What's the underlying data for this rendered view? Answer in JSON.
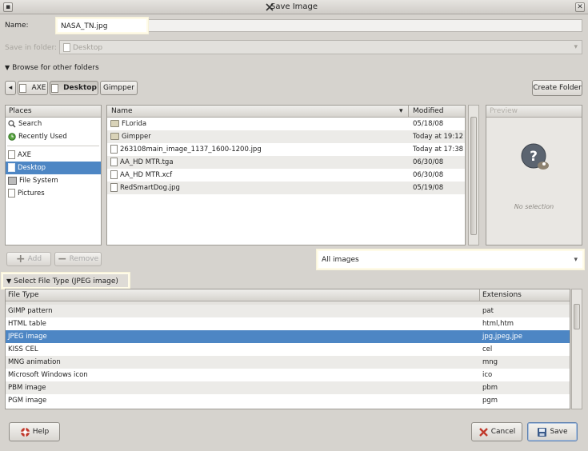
{
  "window": {
    "title": "Save Image",
    "close_glyph": "✕"
  },
  "name_field": {
    "label": "Name:",
    "value": "NASA_TN.jpg"
  },
  "save_in": {
    "label": "Save in folder:",
    "value": "Desktop"
  },
  "browse": {
    "label": "Browse for other folders"
  },
  "path_bar": {
    "items": [
      "AXE",
      "Desktop",
      "Gimpper"
    ],
    "active": "Desktop"
  },
  "create_folder": {
    "label": "Create Folder"
  },
  "places": {
    "header": "Places",
    "items": [
      {
        "label": "Search",
        "icon": "search-icon"
      },
      {
        "label": "Recently Used",
        "icon": "recent-icon"
      },
      {
        "label": "AXE",
        "icon": "home-icon"
      },
      {
        "label": "Desktop",
        "icon": "desktop-icon",
        "selected": true
      },
      {
        "label": "File System",
        "icon": "drive-icon"
      },
      {
        "label": "Pictures",
        "icon": "folder-icon"
      }
    ],
    "add_label": "Add",
    "remove_label": "Remove"
  },
  "files": {
    "col_name": "Name",
    "col_modified": "Modified",
    "rows": [
      {
        "name": "FLorida",
        "modified": "05/18/08",
        "type": "folder"
      },
      {
        "name": "Gimpper",
        "modified": "Today at 19:12",
        "type": "folder"
      },
      {
        "name": "263108main_image_1137_1600-1200.jpg",
        "modified": "Today at 17:38",
        "type": "file"
      },
      {
        "name": "AA_HD MTR.tga",
        "modified": "06/30/08",
        "type": "file"
      },
      {
        "name": "AA_HD MTR.xcf",
        "modified": "06/30/08",
        "type": "file"
      },
      {
        "name": "RedSmartDog.jpg",
        "modified": "05/19/08",
        "type": "file"
      }
    ]
  },
  "preview": {
    "header": "Preview",
    "empty_text": "No selection",
    "icon": "gimp-question-icon"
  },
  "filter": {
    "value": "All images"
  },
  "file_type": {
    "expander_label": "Select File Type (JPEG image)",
    "col_type": "File Type",
    "col_ext": "Extensions",
    "rows": [
      {
        "type": "GIMP pattern",
        "ext": "pat"
      },
      {
        "type": "HTML table",
        "ext": "html,htm"
      },
      {
        "type": "JPEG image",
        "ext": "jpg,jpeg,jpe",
        "selected": true
      },
      {
        "type": "KISS CEL",
        "ext": "cel"
      },
      {
        "type": "MNG animation",
        "ext": "mng"
      },
      {
        "type": "Microsoft Windows icon",
        "ext": "ico"
      },
      {
        "type": "PBM image",
        "ext": "pbm"
      },
      {
        "type": "PGM image",
        "ext": "pgm"
      }
    ]
  },
  "buttons": {
    "help": "Help",
    "cancel": "Cancel",
    "save": "Save"
  },
  "colors": {
    "selection": "#4d86c4",
    "background": "#d6d3ce"
  }
}
